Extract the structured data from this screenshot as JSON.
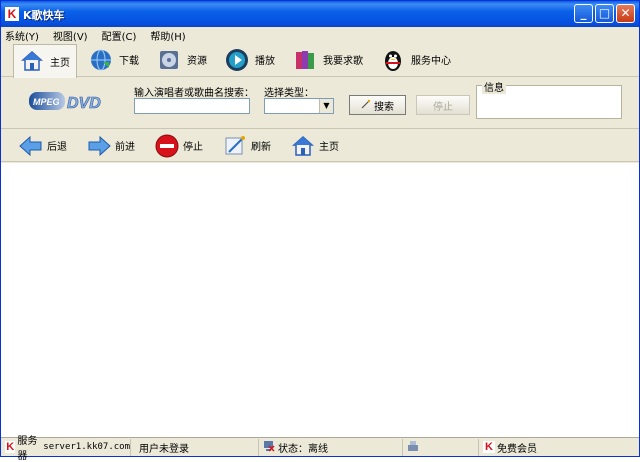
{
  "window": {
    "title": "K歌快车"
  },
  "menu": [
    "系统(Y)",
    "视图(V)",
    "配置(C)",
    "帮助(H)"
  ],
  "tabs": [
    {
      "label": "主页",
      "icon": "home-icon"
    },
    {
      "label": "下载",
      "icon": "globe-download-icon"
    },
    {
      "label": "资源",
      "icon": "disc-resource-icon"
    },
    {
      "label": "播放",
      "icon": "play-icon"
    },
    {
      "label": "我要求歌",
      "icon": "books-request-icon"
    },
    {
      "label": "服务中心",
      "icon": "qq-penguin-icon"
    }
  ],
  "search": {
    "logo_text": "MPEG DVD",
    "query_label": "输入演唱者或歌曲名搜索：",
    "query_value": "",
    "type_label": "选择类型：",
    "type_value": "",
    "search_button": "搜索",
    "stop_button": "停止",
    "info_label": "信息"
  },
  "nav": [
    {
      "label": "后退",
      "icon": "back-arrow-icon"
    },
    {
      "label": "前进",
      "icon": "forward-arrow-icon"
    },
    {
      "label": "停止",
      "icon": "stop-icon"
    },
    {
      "label": "刷新",
      "icon": "refresh-icon"
    },
    {
      "label": "主页",
      "icon": "home-icon"
    }
  ],
  "status": {
    "server_label": "服务器",
    "server_value": "server1.kk07.com",
    "user": "用户未登录",
    "state": "状态：离线",
    "membership": "免费会员"
  },
  "colors": {
    "titlebar": "#0a5ee6",
    "accent_red": "#d8121a",
    "chrome": "#ece9d8"
  }
}
